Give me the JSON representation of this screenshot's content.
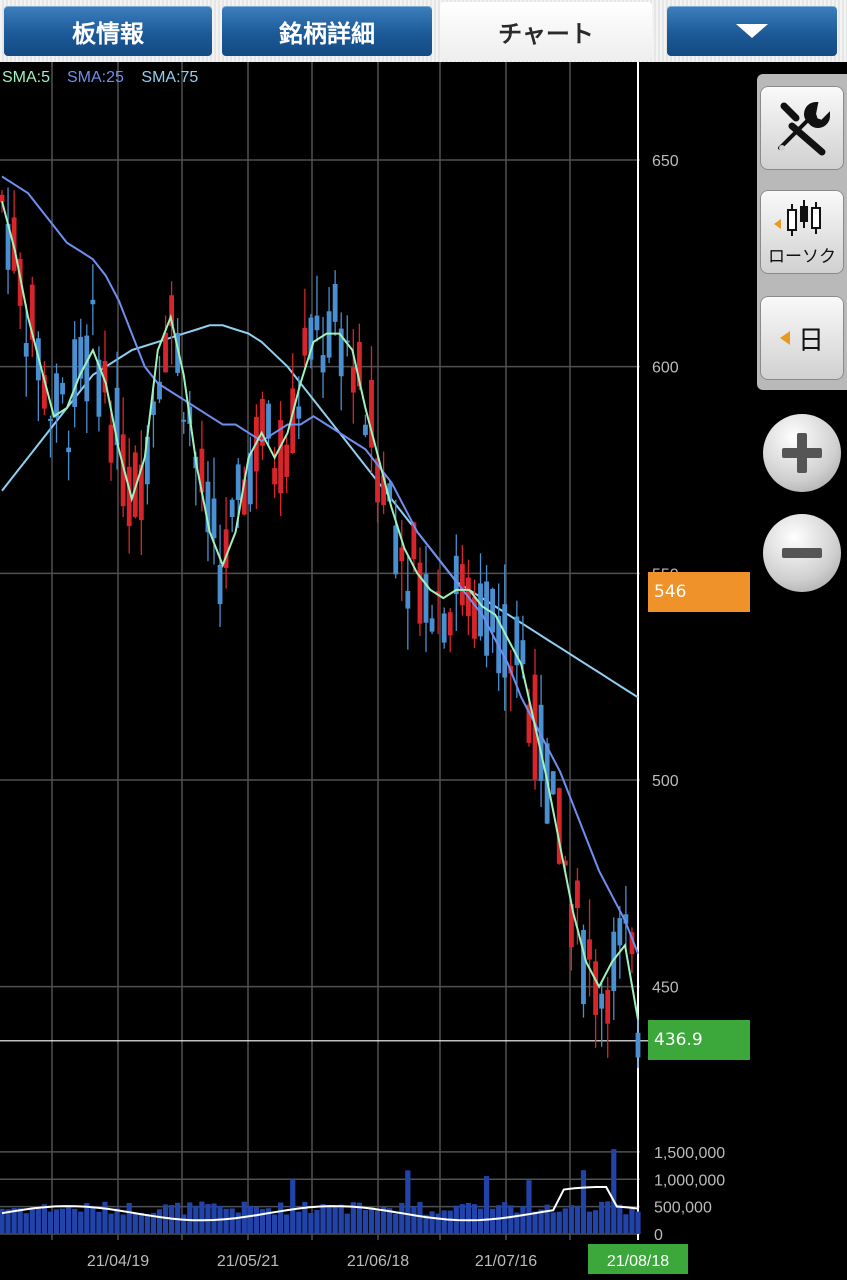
{
  "tabs": [
    {
      "label": "板情報",
      "active": false
    },
    {
      "label": "銘柄詳細",
      "active": false
    },
    {
      "label": "チャート",
      "active": true
    }
  ],
  "legend": [
    {
      "label": "SMA:5",
      "color": "#9ff2bb"
    },
    {
      "label": "SMA:25",
      "color": "#6f8ff0"
    },
    {
      "label": "SMA:75",
      "color": "#8fd0f0"
    }
  ],
  "toolbar": {
    "settings_icon": "tools-icon",
    "chart_type_label": "ローソク",
    "period_label": "日"
  },
  "labels": {
    "reference_price": "546",
    "current_price": "436.9",
    "current_date": "21/08/18"
  },
  "colors": {
    "up_candle": "#d8252b",
    "down_candle": "#4a90d0",
    "volume_bar": "#2244aa",
    "reference_tag": "#f0922a",
    "current_tag": "#3ca83c",
    "grid": "#505050"
  },
  "chart_data": {
    "type": "candlestick",
    "price_ticks": [
      650,
      600,
      550,
      500,
      450
    ],
    "volume_ticks": [
      1500000,
      1000000,
      500000,
      0
    ],
    "volume_tick_labels": [
      "1,500,000",
      "1,000,000",
      "500,000",
      "0"
    ],
    "x_tick_labels": [
      "21/04/19",
      "21/05/21",
      "21/06/18",
      "21/07/16",
      "21/08/18"
    ],
    "ylim": [
      384,
      670
    ],
    "volume_ylim": [
      0,
      1900000
    ],
    "series": [
      {
        "name": "SMA:5",
        "approx_values": [
          640,
          628,
          612,
          600,
          588,
          590,
          598,
          604,
          596,
          580,
          568,
          578,
          604,
          612,
          598,
          576,
          560,
          552,
          560,
          578,
          584,
          578,
          584,
          596,
          606,
          608,
          608,
          604,
          590,
          578,
          566,
          556,
          550,
          546,
          544,
          546,
          546,
          542,
          540,
          534,
          528,
          514,
          500,
          484,
          468,
          456,
          450,
          456,
          460,
          442
        ]
      },
      {
        "name": "SMA:25",
        "approx_values": [
          646,
          644,
          642,
          638,
          634,
          630,
          628,
          626,
          622,
          616,
          608,
          600,
          596,
          594,
          592,
          590,
          588,
          586,
          586,
          584,
          582,
          584,
          586,
          586,
          588,
          586,
          584,
          582,
          580,
          576,
          572,
          566,
          560,
          556,
          552,
          548,
          544,
          540,
          534,
          528,
          520,
          514,
          508,
          502,
          494,
          486,
          478,
          472,
          466,
          458
        ]
      },
      {
        "name": "SMA:75",
        "approx_values": [
          570,
          574,
          578,
          582,
          586,
          590,
          594,
          598,
          600,
          602,
          604,
          605,
          606,
          607,
          608,
          609,
          610,
          610,
          609,
          608,
          606,
          603,
          600,
          596,
          592,
          588,
          584,
          580,
          576,
          572,
          568,
          564,
          560,
          556,
          552,
          548,
          546,
          544,
          542,
          540,
          538,
          536,
          534,
          532,
          530,
          528,
          526,
          524,
          522,
          520
        ]
      }
    ],
    "last_close": 436.9
  }
}
